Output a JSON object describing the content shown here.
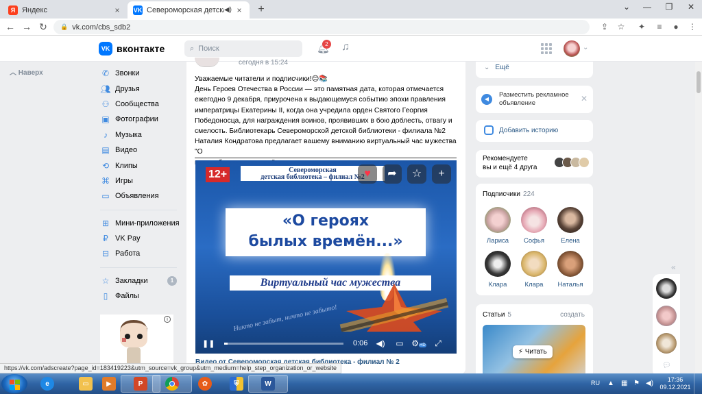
{
  "browser": {
    "tabs": [
      {
        "label": "Яндекс",
        "favicon": "yandex-icon",
        "active": false
      },
      {
        "label": "Североморская детская биб",
        "favicon": "vk-icon",
        "active": true,
        "audio": true
      }
    ],
    "new_tab": "+",
    "url": "vk.com/cbs_sdb2",
    "status_url": "https://vk.com/adscreate?page_id=183419223&utm_source=vk_group&utm_medium=help_step_organization_or_website"
  },
  "vk": {
    "logo_text": "вконтакте",
    "search_placeholder": "Поиск",
    "notifications_count": "2",
    "back_label": "Наверх"
  },
  "left_menu": {
    "items": [
      {
        "label": "Звонки",
        "icon": "phone-icon"
      },
      {
        "label": "Друзья",
        "icon": "friends-icon"
      },
      {
        "label": "Сообщества",
        "icon": "communities-icon"
      },
      {
        "label": "Фотографии",
        "icon": "photo-icon"
      },
      {
        "label": "Музыка",
        "icon": "music-icon"
      },
      {
        "label": "Видео",
        "icon": "video-icon"
      },
      {
        "label": "Клипы",
        "icon": "clips-icon"
      },
      {
        "label": "Игры",
        "icon": "games-icon"
      },
      {
        "label": "Объявления",
        "icon": "ads-icon"
      }
    ],
    "items2": [
      {
        "label": "Мини-приложения",
        "icon": "apps-icon"
      },
      {
        "label": "VK Pay",
        "icon": "vkpay-icon"
      },
      {
        "label": "Работа",
        "icon": "work-icon"
      }
    ],
    "items3": [
      {
        "label": "Закладки",
        "icon": "bookmark-icon",
        "count": "1"
      },
      {
        "label": "Файлы",
        "icon": "file-icon"
      }
    ]
  },
  "post": {
    "time": "сегодня в 15:24",
    "text": [
      "Уважаемые читатели и подписчики!😊📚",
      "День Героев Отечества в России — это памятная дата, которая отмечается",
      "ежегодно 9 декабря, приурочена к выдающемуся событию эпохи правления",
      "императрицы Екатерины II, когда она учредила орден Святого Георгия",
      "Победоносца, для награждения воинов, проявивших в бою доблесть, отвагу и",
      "смелость. Библиотекарь Североморской детской библиотеки - филиала №2",
      "Наталия Кондратова предлагает вашему вниманию виртуальный час мужества \"О",
      "героях былых времен...\""
    ],
    "video": {
      "age_badge": "12+",
      "org_line1": "Североморская",
      "org_line2": "детская библиотека – филиал №2",
      "title_line1": "«О героях",
      "title_line2": "былых времён...»",
      "subtitle": "Виртуальный час мужества",
      "script_text": "Никто не забыт, ничто не забыто!",
      "time": "0:06",
      "progress": 0.03,
      "hd_label": "HD"
    },
    "caption": "Видео от Североморская детская библиотека - филиал № 2"
  },
  "right": {
    "more_label": "Ещё",
    "ad_text": "Разместить рекламное объявление",
    "story_label": "Добавить историю",
    "recommend_line1": "Рекомендуете",
    "recommend_line2": "вы и ещё 4 друга",
    "subscribers_label": "Подписчики",
    "subscribers_count": "224",
    "subscribers": [
      {
        "name": "Лариса",
        "color": "#c9a2a2"
      },
      {
        "name": "Софья",
        "color": "#e6a9b5"
      },
      {
        "name": "Елена",
        "color": "#5a4438"
      },
      {
        "name": "Клара",
        "color": "#3a3a3a"
      },
      {
        "name": "Клара",
        "color": "#d9b56a"
      },
      {
        "name": "Наталья",
        "color": "#8a5a3a"
      }
    ],
    "articles_label": "Статьи",
    "articles_count": "5",
    "create_label": "создать",
    "read_label": "Читать"
  },
  "taskbar": {
    "lang": "RU",
    "time": "17:36",
    "date": "09.12.2021",
    "apps": [
      "ie-icon",
      "explorer-icon",
      "media-icon",
      "powerpoint-icon",
      "chrome-icon",
      "player-icon",
      "security-icon",
      "word-icon"
    ]
  }
}
